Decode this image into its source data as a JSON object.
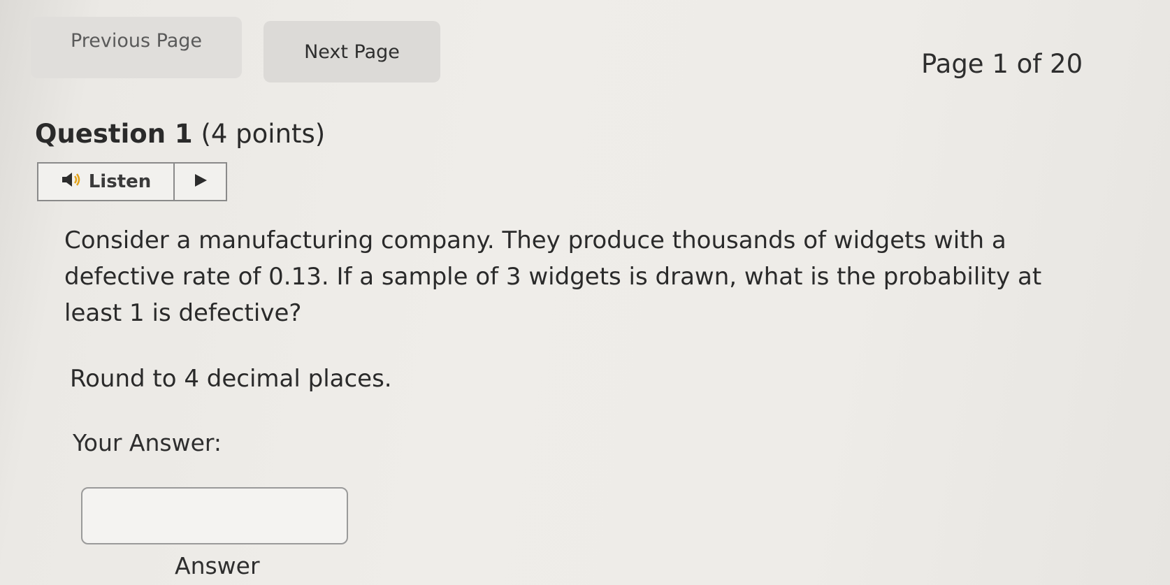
{
  "nav": {
    "previous_label": "Previous Page",
    "next_label": "Next Page",
    "page_indicator": "Page 1 of 20"
  },
  "question": {
    "title_number": "Question 1",
    "title_points": "(4 points)",
    "listen_label": "Listen",
    "body": "Consider a manufacturing company. They produce thousands of widgets with a defective rate of 0.13. If a sample of 3 widgets is drawn, what is the probability at least 1 is defective?",
    "rounding_note": "Round to 4 decimal places."
  },
  "answer": {
    "label": "Your Answer:",
    "value": "",
    "caption": "Answer"
  },
  "icons": {
    "listen": "speaker-icon",
    "play": "play-icon"
  },
  "colors": {
    "background": "#eeece8",
    "button_bg": "#e0dedb",
    "border": "#8a8a8a"
  }
}
